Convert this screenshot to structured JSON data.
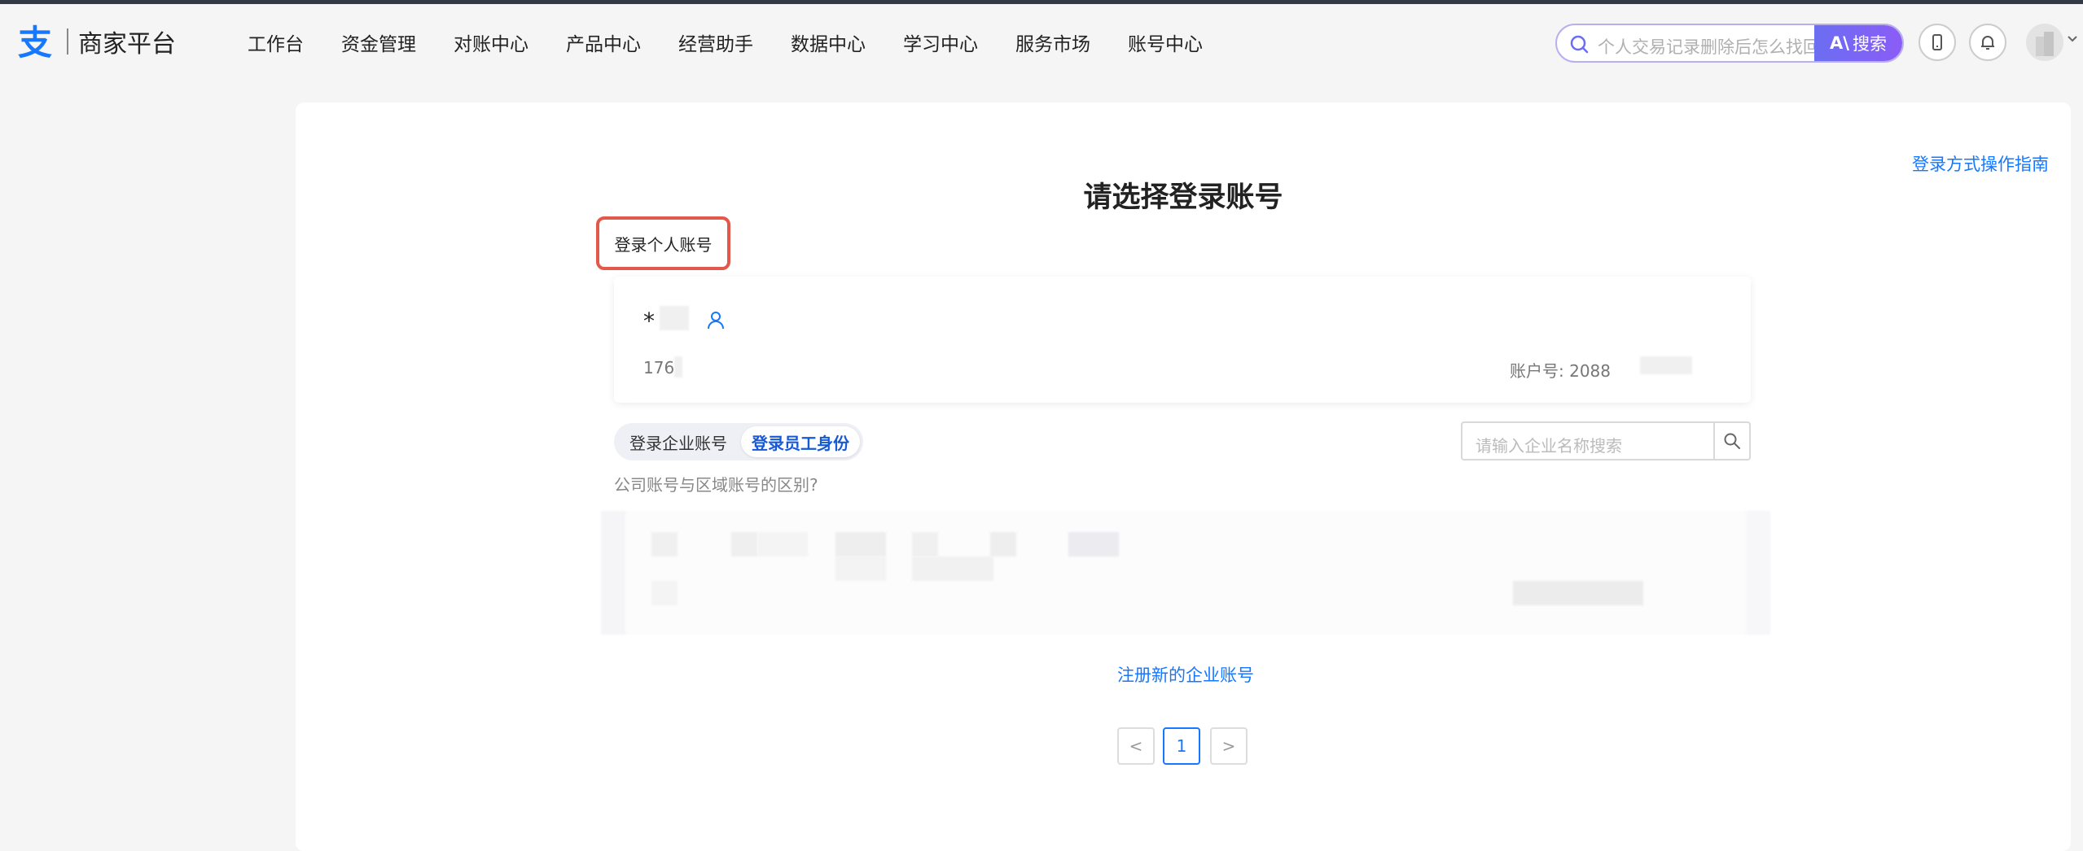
{
  "brand": {
    "name": "商家平台",
    "accent": "#1677ff"
  },
  "nav": {
    "items": [
      "工作台",
      "资金管理",
      "对账中心",
      "产品中心",
      "经营助手",
      "数据中心",
      "学习中心",
      "服务市场",
      "账号中心"
    ]
  },
  "search": {
    "placeholder": "个人交易记录删除后怎么找回",
    "button_label": "搜索",
    "ai_mark": "A\\"
  },
  "header_icons": [
    "mobile-icon",
    "bell-icon",
    "avatar",
    "chevron-down-icon"
  ],
  "main": {
    "guide_link": "登录方式操作指南",
    "title": "请选择登录账号",
    "personal_tab": "登录个人账号",
    "account": {
      "name": "*",
      "phone": "176",
      "account_no": "账户号: 2088"
    },
    "segment": {
      "enterprise": "登录企业账号",
      "employee": "登录员工身份",
      "active": "employee"
    },
    "enterprise_search_placeholder": "请输入企业名称搜索",
    "difference_link": "公司账号与区域账号的区别?",
    "register_link": "注册新的企业账号",
    "pagination": {
      "prev": "<",
      "current": "1",
      "next": ">"
    }
  }
}
